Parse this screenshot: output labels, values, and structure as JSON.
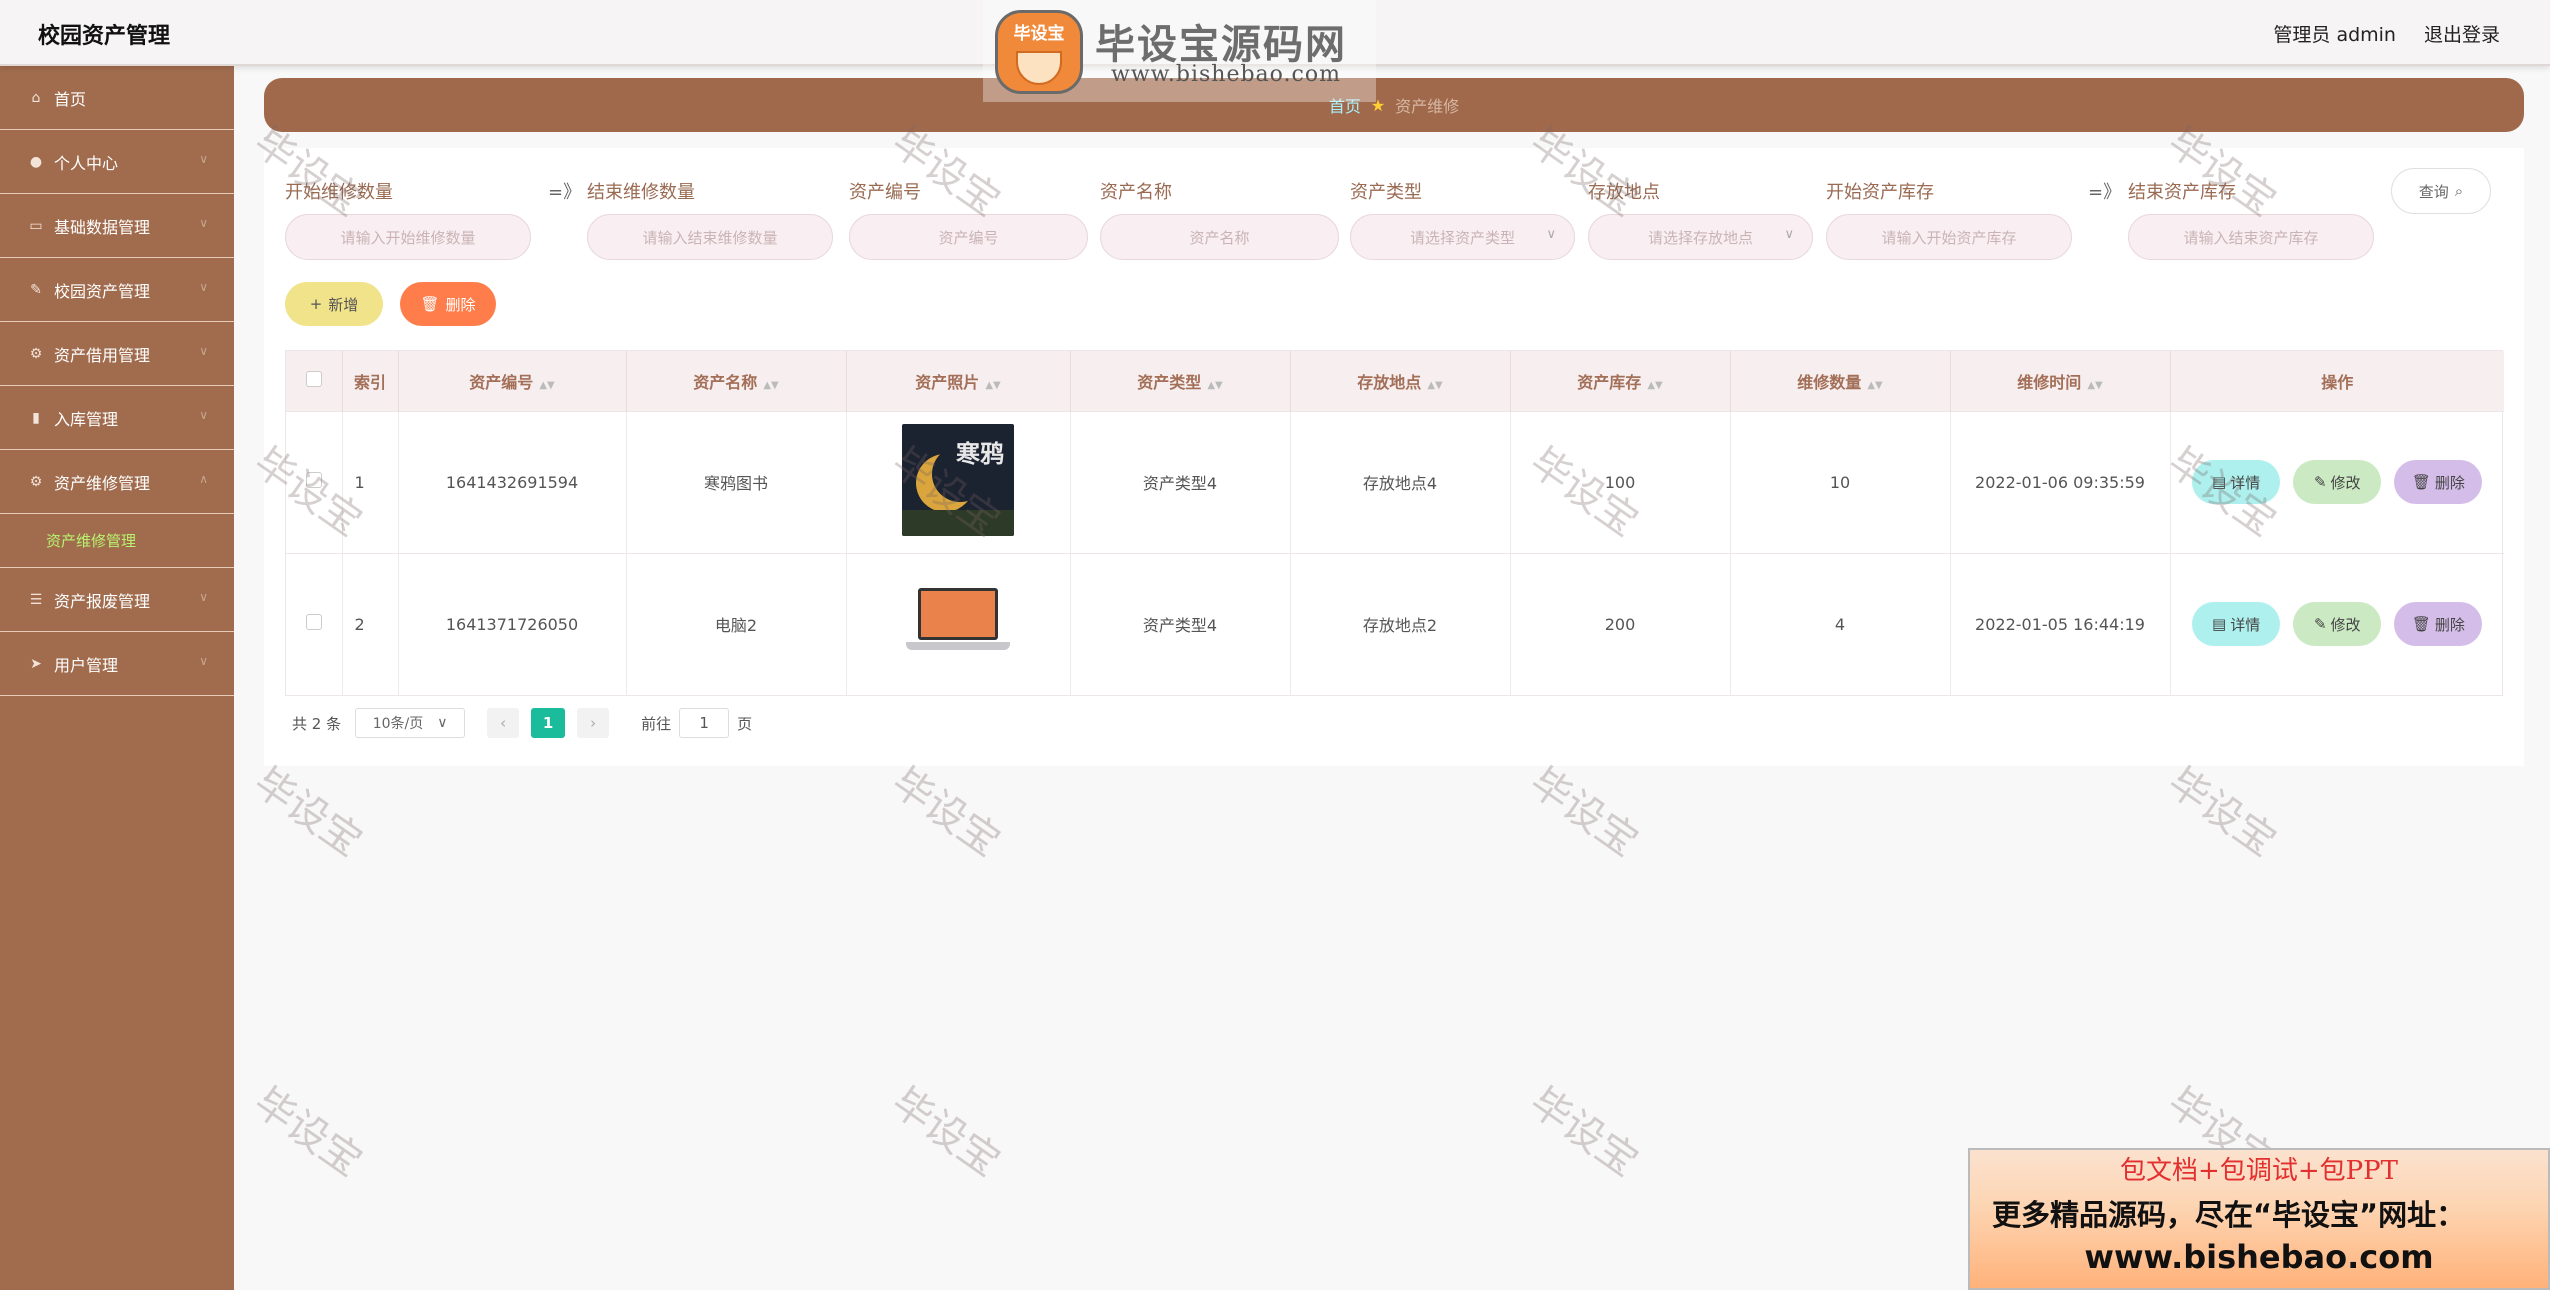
{
  "header": {
    "title": "校园资产管理",
    "user_label": "管理员 admin",
    "logout_label": "退出登录"
  },
  "logo_watermark": {
    "badge": "毕设宝",
    "title": "毕设宝源码网",
    "url": "www.bishebao.com"
  },
  "sidebar": {
    "items": [
      {
        "label": "首页",
        "icon": "home-icon"
      },
      {
        "label": "个人中心",
        "icon": "user-icon"
      },
      {
        "label": "基础数据管理",
        "icon": "document-icon"
      },
      {
        "label": "校园资产管理",
        "icon": "edit-icon"
      },
      {
        "label": "资产借用管理",
        "icon": "gear-icon"
      },
      {
        "label": "入库管理",
        "icon": "clipboard-icon"
      },
      {
        "label": "资产维修管理",
        "icon": "gear-icon"
      },
      {
        "label": "资产报废管理",
        "icon": "list-icon"
      },
      {
        "label": "用户管理",
        "icon": "send-icon"
      }
    ],
    "submenu_active": "资产维修管理"
  },
  "breadcrumb": {
    "home": "首页",
    "current": "资产维修"
  },
  "search": {
    "fields": [
      {
        "label": "开始维修数量",
        "placeholder": "请输入开始维修数量"
      },
      {
        "label": "结束维修数量",
        "placeholder": "请输入结束维修数量"
      },
      {
        "label": "资产编号",
        "placeholder": "资产编号"
      },
      {
        "label": "资产名称",
        "placeholder": "资产名称"
      },
      {
        "label": "资产类型",
        "placeholder": "请选择资产类型"
      },
      {
        "label": "存放地点",
        "placeholder": "请选择存放地点"
      },
      {
        "label": "开始资产库存",
        "placeholder": "请输入开始资产库存"
      },
      {
        "label": "结束资产库存",
        "placeholder": "请输入结束资产库存"
      }
    ],
    "range_arrow": "=》",
    "query_label": "查询"
  },
  "actions": {
    "add_label": "新增",
    "delete_label": "删除"
  },
  "table": {
    "columns": [
      "索引",
      "资产编号",
      "资产名称",
      "资产照片",
      "资产类型",
      "存放地点",
      "资产库存",
      "维修数量",
      "维修时间",
      "操作"
    ],
    "rows": [
      {
        "index": "1",
        "code": "1641432691594",
        "name": "寒鸦图书",
        "photo": "book-cover",
        "photo_text": "寒鸦",
        "type": "资产类型4",
        "location": "存放地点4",
        "stock": "100",
        "repair_count": "10",
        "repair_time": "2022-01-06 09:35:59"
      },
      {
        "index": "2",
        "code": "1641371726050",
        "name": "电脑2",
        "photo": "laptop",
        "photo_text": "",
        "type": "资产类型4",
        "location": "存放地点2",
        "stock": "200",
        "repair_count": "4",
        "repair_time": "2022-01-05 16:44:19"
      }
    ],
    "row_actions": {
      "detail": "详情",
      "edit": "修改",
      "delete": "删除"
    }
  },
  "pagination": {
    "total": "共 2 条",
    "page_size": "10条/页",
    "current_page": "1",
    "goto_label": "前往",
    "goto_value": "1",
    "page_unit": "页"
  },
  "watermark_text": "毕设宝",
  "ad": {
    "line1": "包文档+包调试+包PPT",
    "line2": "更多精品源码，尽在“毕设宝”网址：",
    "line3": "www.bishebao.com"
  },
  "colors": {
    "sidebar": "#a16c4e",
    "breadcrumb_bar": "#a0694b",
    "accent_green": "#1bbc9b",
    "delete_orange": "#ff7d4a"
  }
}
